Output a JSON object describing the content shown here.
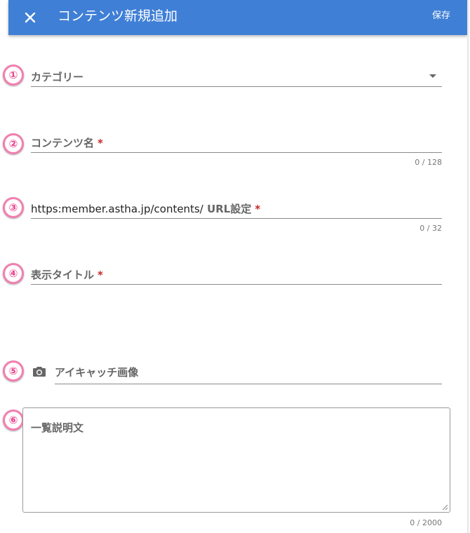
{
  "toolbar": {
    "title": "コンテンツ新規追加",
    "save_label": "保存",
    "close_icon": "close-icon",
    "background_color": "#3f7fd6"
  },
  "markers": [
    "①",
    "②",
    "③",
    "④",
    "⑤",
    "⑥"
  ],
  "marker_color": "#ea3e8c",
  "form": {
    "category": {
      "label": "カテゴリー",
      "value": ""
    },
    "content_name": {
      "label": "コンテンツ名",
      "required_mark": "*",
      "value": "",
      "counter": "0 / 128"
    },
    "url": {
      "prefix": "https:member.astha.jp/contents/",
      "label": "URL設定",
      "required_mark": "*",
      "value": "",
      "counter": "0 / 32"
    },
    "display_title": {
      "label": "表示タイトル",
      "required_mark": "*",
      "value": ""
    },
    "eyecatch": {
      "icon": "camera-icon",
      "label": "アイキャッチ画像"
    },
    "description": {
      "label": "一覧説明文",
      "value": "",
      "counter": "0 / 2000"
    }
  }
}
